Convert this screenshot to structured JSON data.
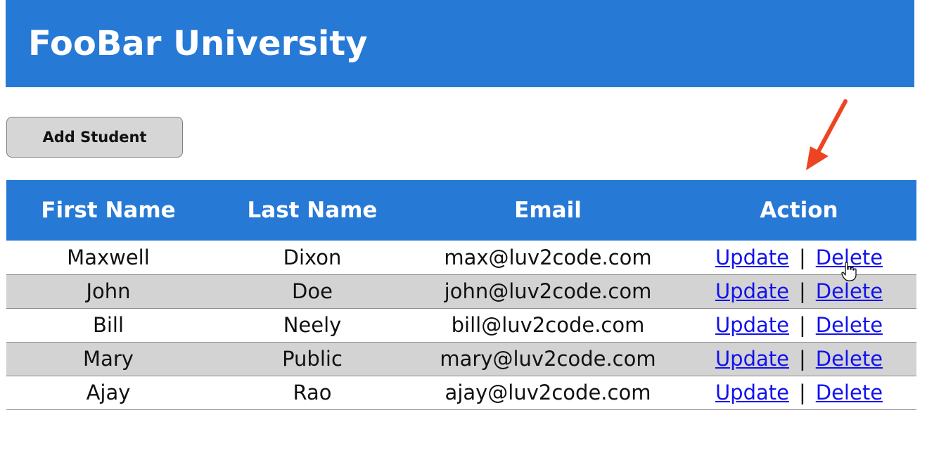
{
  "header": {
    "title": "FooBar University",
    "color": "#2779d6"
  },
  "toolbar": {
    "add_label": "Add Student"
  },
  "table": {
    "columns": [
      "First Name",
      "Last Name",
      "Email",
      "Action"
    ],
    "rows": [
      {
        "first": "Maxwell",
        "last": "Dixon",
        "email": "max@luv2code.com",
        "update": "Update",
        "sep": "|",
        "delete": "Delete"
      },
      {
        "first": "John",
        "last": "Doe",
        "email": "john@luv2code.com",
        "update": "Update",
        "sep": "|",
        "delete": "Delete"
      },
      {
        "first": "Bill",
        "last": "Neely",
        "email": "bill@luv2code.com",
        "update": "Update",
        "sep": "|",
        "delete": "Delete"
      },
      {
        "first": "Mary",
        "last": "Public",
        "email": "mary@luv2code.com",
        "update": "Update",
        "sep": "|",
        "delete": "Delete"
      },
      {
        "first": "Ajay",
        "last": "Rao",
        "email": "ajay@luv2code.com",
        "update": "Update",
        "sep": "|",
        "delete": "Delete"
      }
    ]
  },
  "annotation": {
    "arrow_icon": "red-arrow-icon",
    "arrow_color": "#ee4422",
    "cursor_icon": "hand-pointer-icon"
  }
}
